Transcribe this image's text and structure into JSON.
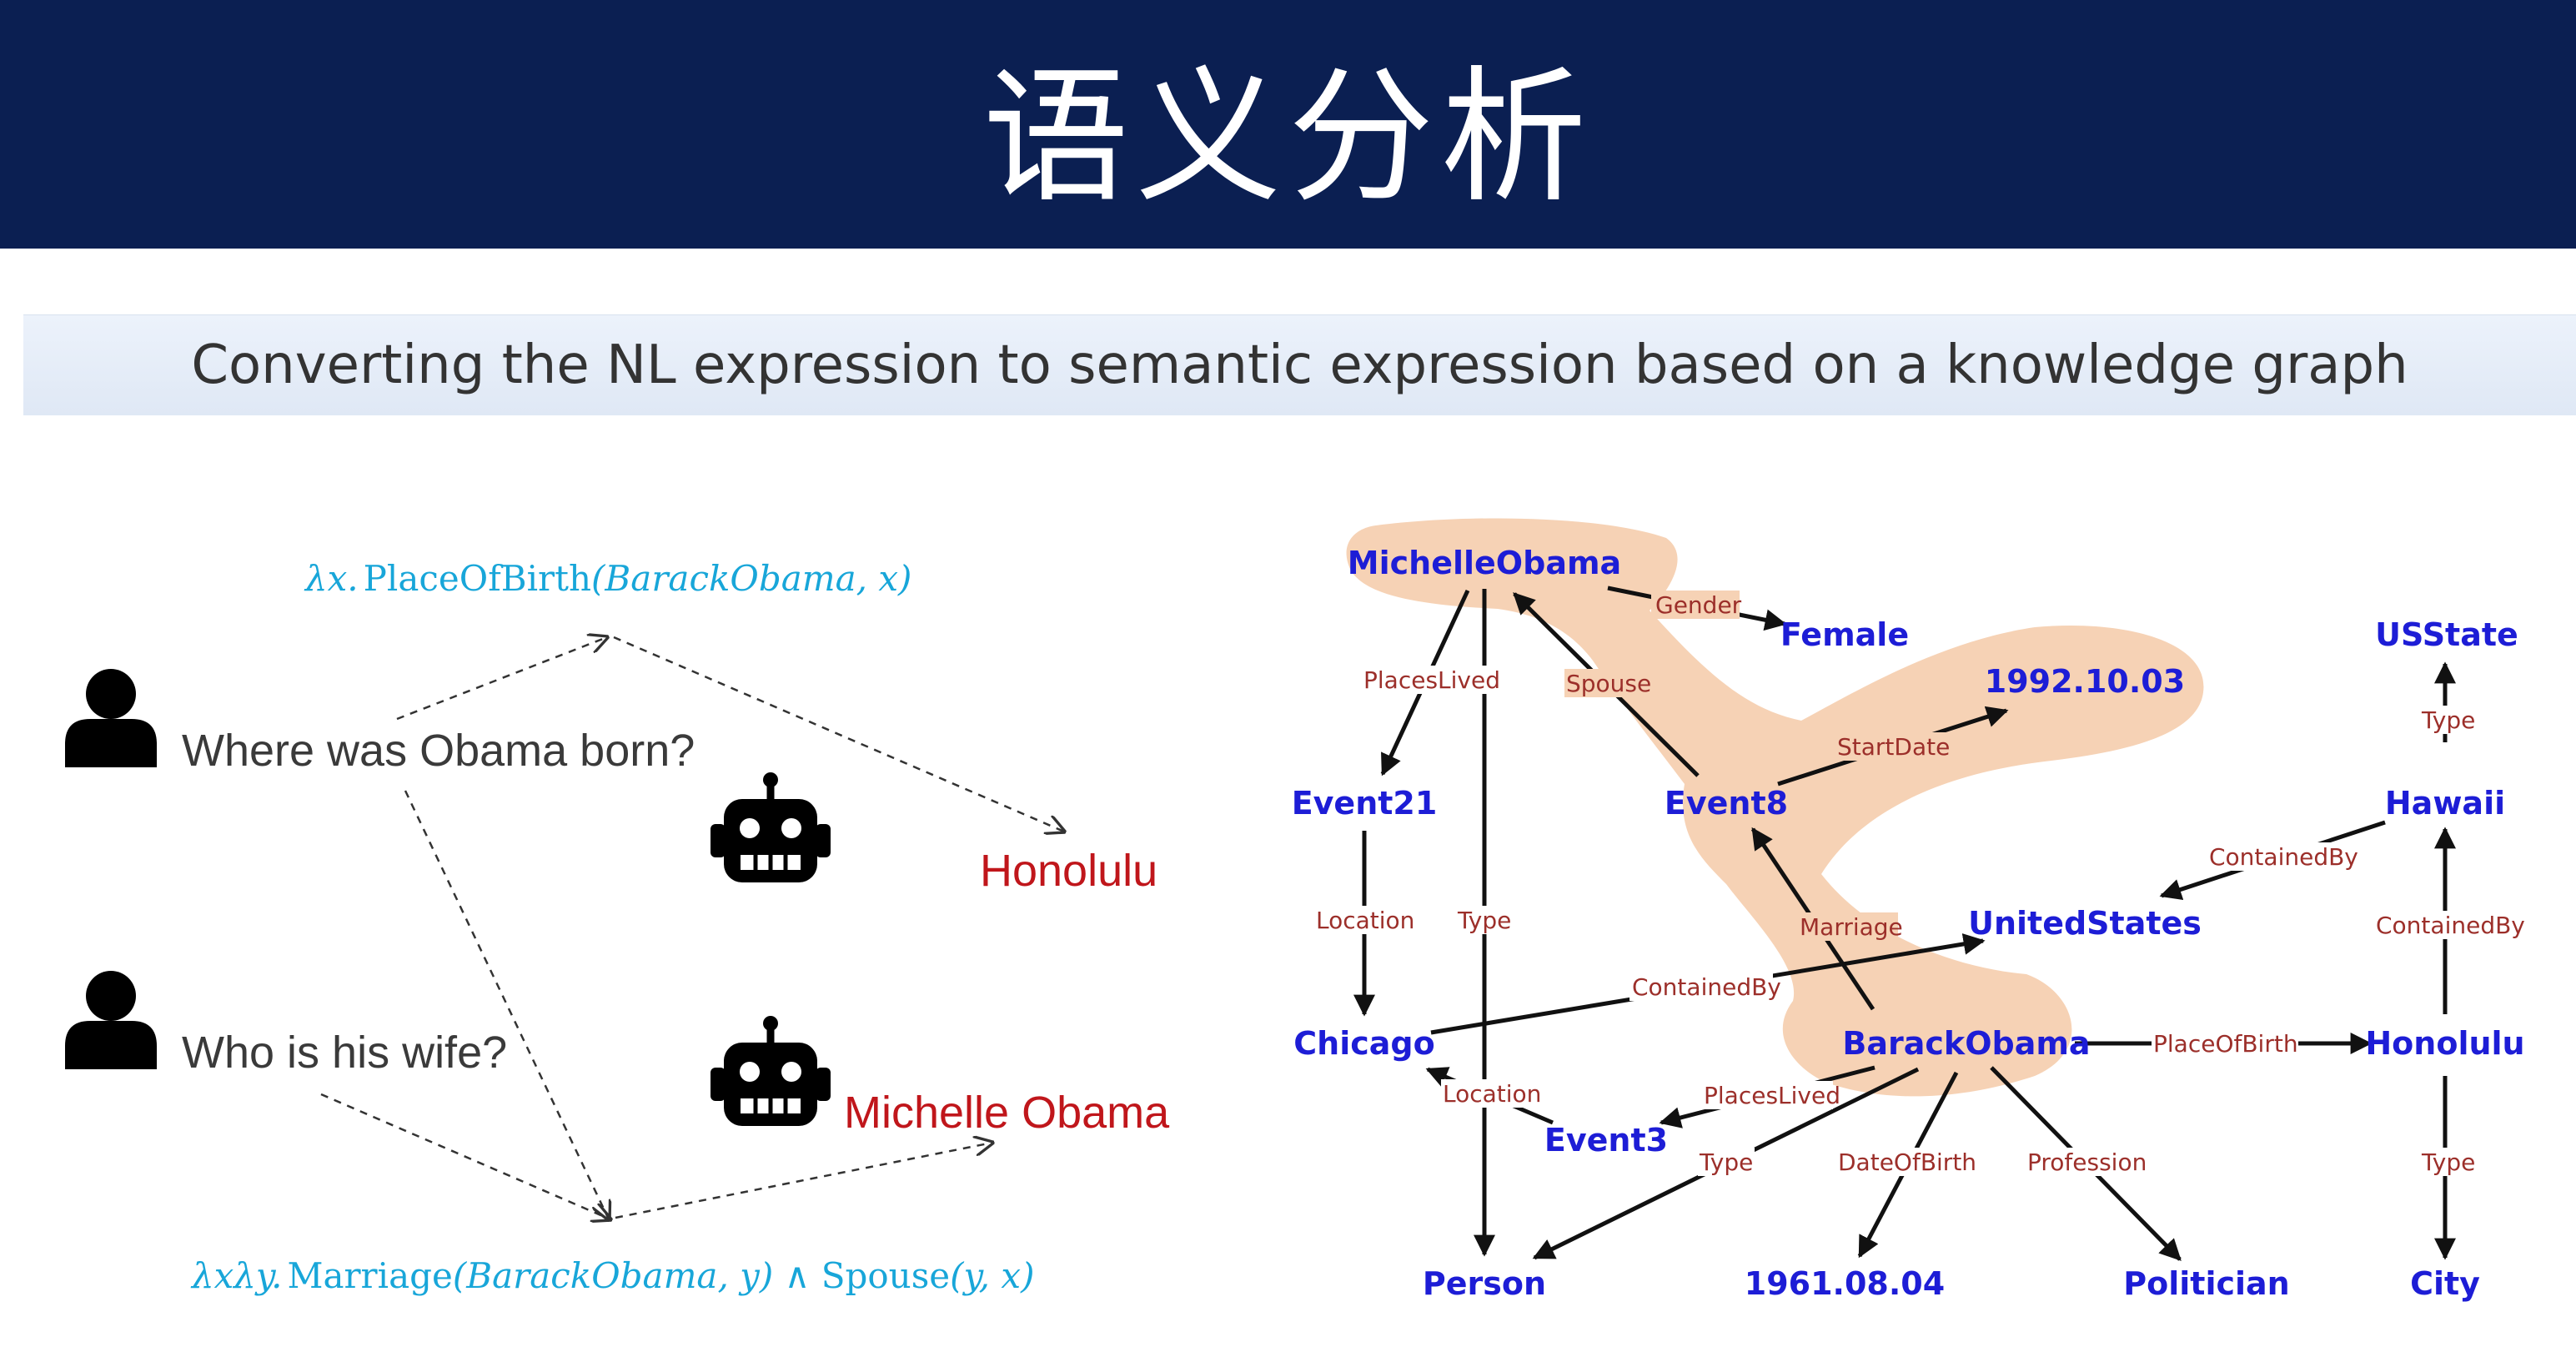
{
  "header": {
    "title": "语义分析"
  },
  "subtitle": "Converting the NL expression to semantic expression based on a knowledge graph",
  "dialogue": {
    "question1": "Where was Obama born?",
    "answer1": "Honolulu",
    "question2": "Who is his wife?",
    "answer2": "Michelle Obama",
    "lf1": {
      "lambda": "λx.",
      "pred": "PlaceOfBirth",
      "args": "(BarackObama, x)"
    },
    "lf2": {
      "lambda": "λxλy.",
      "pred1": "Marriage",
      "args1": "(BarackObama, y)",
      "and": " ∧ ",
      "pred2": "Spouse",
      "args2": "(y, x)"
    },
    "icons": [
      "person-icon",
      "robot-icon"
    ]
  },
  "graph": {
    "nodes": {
      "michelle": "MichelleObama",
      "female": "Female",
      "date1992": "1992.10.03",
      "usstate": "USState",
      "event21": "Event21",
      "event8": "Event8",
      "hawaii": "Hawaii",
      "unitedstates": "UnitedStates",
      "chicago": "Chicago",
      "barack": "BarackObama",
      "honolulu": "Honolulu",
      "event3": "Event3",
      "person": "Person",
      "date1961": "1961.08.04",
      "politician": "Politician",
      "city": "City"
    },
    "edges": {
      "gender": "Gender",
      "placeslived1": "PlacesLived",
      "spouse": "Spouse",
      "startdate": "StartDate",
      "type_usstate": "Type",
      "location1": "Location",
      "type_person1": "Type",
      "containedby_hawaii": "ContainedBy",
      "marriage": "Marriage",
      "containedby_honolulu": "ContainedBy",
      "containedby_chicago": "ContainedBy",
      "placeofbirth": "PlaceOfBirth",
      "location2": "Location",
      "placeslived2": "PlacesLived",
      "type_person2": "Type",
      "dateofbirth": "DateOfBirth",
      "profession": "Profession",
      "type_city": "Type"
    },
    "colors": {
      "node": "#1d1dd6",
      "edge_label": "#9c2f2a",
      "highlight": "#f6d2b5"
    }
  }
}
